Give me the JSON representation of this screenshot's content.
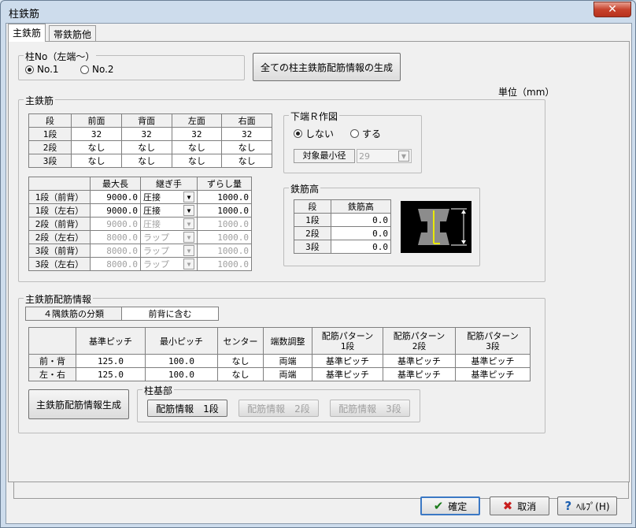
{
  "window": {
    "title": "柱鉄筋",
    "close": "✕"
  },
  "tabs": [
    {
      "label": "主鉄筋"
    },
    {
      "label": "帯鉄筋他"
    }
  ],
  "column_no": {
    "legend": "柱No（左端～）",
    "options": [
      "No.1",
      "No.2"
    ],
    "selected": 0
  },
  "generate_all_button": "全ての柱主鉄筋配筋情報の生成",
  "unit_label": "単位（mm）",
  "main_rebar": {
    "legend": "主鉄筋",
    "table1": {
      "headers": [
        "段",
        "前面",
        "背面",
        "左面",
        "右面"
      ],
      "rows": [
        [
          "1段",
          "32",
          "32",
          "32",
          "32"
        ],
        [
          "2段",
          "なし",
          "なし",
          "なし",
          "なし"
        ],
        [
          "3段",
          "なし",
          "なし",
          "なし",
          "なし"
        ]
      ]
    },
    "table2": {
      "headers": [
        "",
        "最大長",
        "継ぎ手",
        "ずらし量"
      ],
      "rows": [
        {
          "label": "1段（前背）",
          "max": "9000.0",
          "joint": "圧接",
          "shift": "1000.0",
          "enabled": true
        },
        {
          "label": "1段（左右）",
          "max": "9000.0",
          "joint": "圧接",
          "shift": "1000.0",
          "enabled": true
        },
        {
          "label": "2段（前背）",
          "max": "9000.0",
          "joint": "圧接",
          "shift": "1000.0",
          "enabled": false
        },
        {
          "label": "2段（左右）",
          "max": "8000.0",
          "joint": "ラップ",
          "shift": "1000.0",
          "enabled": false
        },
        {
          "label": "3段（前背）",
          "max": "8000.0",
          "joint": "ラップ",
          "shift": "1000.0",
          "enabled": false
        },
        {
          "label": "3段（左右）",
          "max": "8000.0",
          "joint": "ラップ",
          "shift": "1000.0",
          "enabled": false
        }
      ]
    },
    "lower_r": {
      "legend": "下端Ｒ作図",
      "options": [
        "しない",
        "する"
      ],
      "selected": 0,
      "target_label": "対象最小径",
      "target_value": "29"
    },
    "rebar_height": {
      "legend": "鉄筋高",
      "headers": [
        "段",
        "鉄筋高"
      ],
      "rows": [
        [
          "1段",
          "0.0"
        ],
        [
          "2段",
          "0.0"
        ],
        [
          "3段",
          "0.0"
        ]
      ]
    }
  },
  "arrangement": {
    "legend": "主鉄筋配筋情報",
    "corner_label": "４隅鉄筋の分類",
    "corner_value": "前背に含む",
    "headers": [
      "",
      "基準ピッチ",
      "最小ピッチ",
      "センター",
      "端数調整",
      "配筋パターン\n1段",
      "配筋パターン\n2段",
      "配筋パターン\n3段"
    ],
    "rows": [
      [
        "前・背",
        "125.0",
        "100.0",
        "なし",
        "両端",
        "基準ピッチ",
        "基準ピッチ",
        "基準ピッチ"
      ],
      [
        "左・右",
        "125.0",
        "100.0",
        "なし",
        "両端",
        "基準ピッチ",
        "基準ピッチ",
        "基準ピッチ"
      ]
    ],
    "generate_button": "主鉄筋配筋情報生成",
    "base": {
      "legend": "柱基部",
      "buttons": [
        "配筋情報　1段",
        "配筋情報　2段",
        "配筋情報　3段"
      ]
    }
  },
  "footer": {
    "ok": "確定",
    "cancel": "取消",
    "help": "ﾍﾙﾌﾟ(H)"
  }
}
